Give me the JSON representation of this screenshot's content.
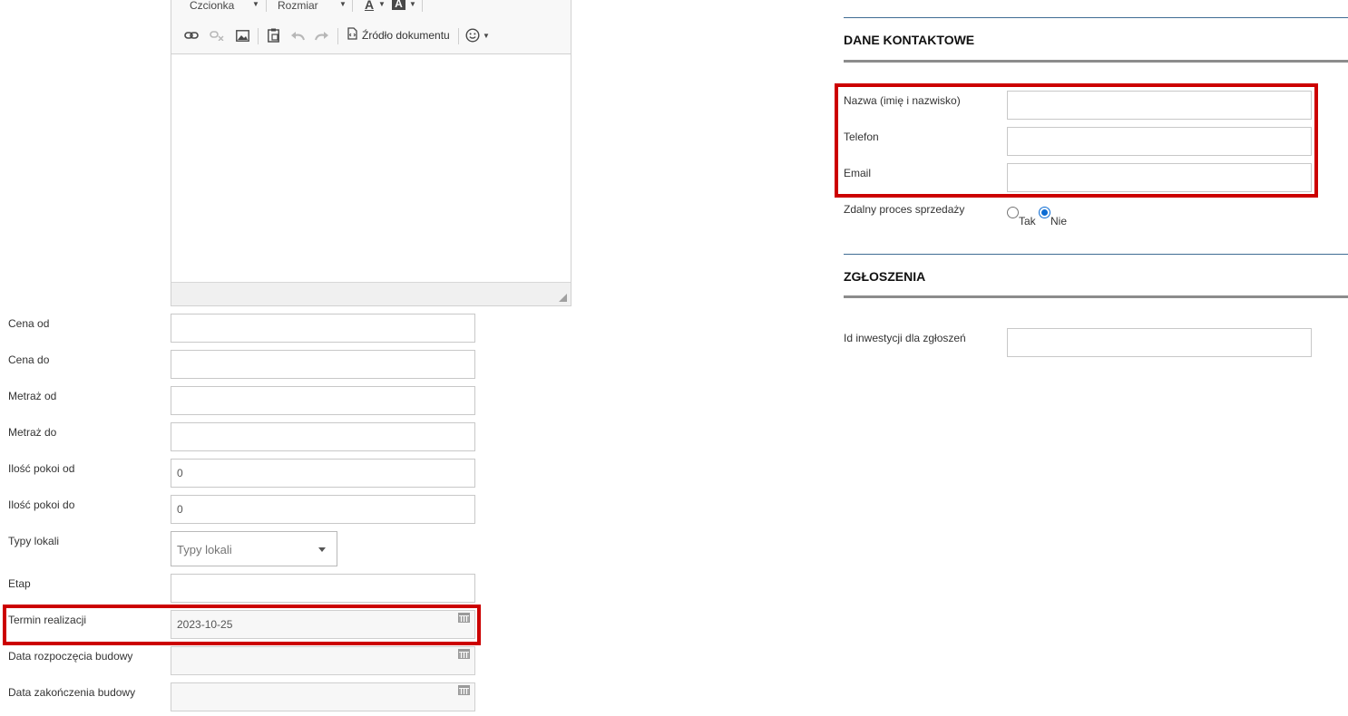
{
  "editor": {
    "font_combo": "Czcionka",
    "size_combo": "Rozmiar",
    "text_color_glyph": "A",
    "bg_color_glyph": "A",
    "source_label": "Źródło dokumentu",
    "icons": [
      "link-icon",
      "unlink-icon",
      "image-icon",
      "paste-icon",
      "undo-icon",
      "redo-icon",
      "source-icon",
      "emoji-icon"
    ]
  },
  "left_form": {
    "fields": [
      {
        "label": "Cena od",
        "value": ""
      },
      {
        "label": "Cena do",
        "value": ""
      },
      {
        "label": "Metraż od",
        "value": ""
      },
      {
        "label": "Metraż do",
        "value": ""
      },
      {
        "label": "Ilość pokoi od",
        "value": "0"
      },
      {
        "label": "Ilość pokoi do",
        "value": "0"
      }
    ],
    "types": {
      "label": "Typy lokali",
      "placeholder": "Typy lokali"
    },
    "stage": {
      "label": "Etap",
      "value": ""
    },
    "completion": {
      "label": "Termin realizacji",
      "value": "2023-10-25"
    },
    "build_start": {
      "label": "Data rozpoczęcia budowy",
      "value": ""
    },
    "build_end": {
      "label": "Data zakończenia budowy",
      "value": ""
    }
  },
  "contact": {
    "title": "DANE KONTAKTOWE",
    "name_label": "Nazwa (imię i nazwisko)",
    "phone_label": "Telefon",
    "email_label": "Email",
    "remote_label": "Zdalny proces sprzedaży",
    "yes_label": "Tak",
    "no_label": "Nie",
    "remote_selected": "Nie"
  },
  "reports": {
    "title": "ZGŁOSZENIA",
    "invest_id_label": "Id inwestycji dla zgłoszeń",
    "invest_id_value": ""
  },
  "colors": {
    "highlight": "#cc0000",
    "section_line": "#3f6c93",
    "radio_selected": "#0b6bd3"
  }
}
